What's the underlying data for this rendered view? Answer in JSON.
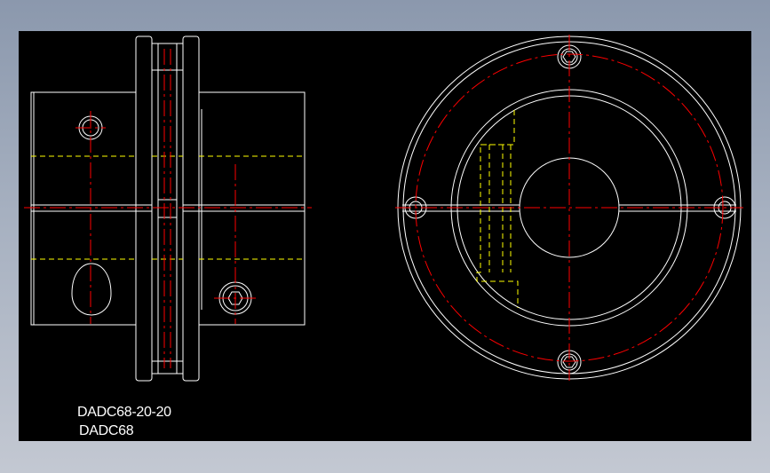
{
  "drawing": {
    "label_part_number": "DADC68-20-20",
    "label_series": "DADC68"
  },
  "colors": {
    "background": "#000000",
    "outline": "#ffffff",
    "centerline": "#ff0000",
    "hidden_line": "#ffff00"
  }
}
